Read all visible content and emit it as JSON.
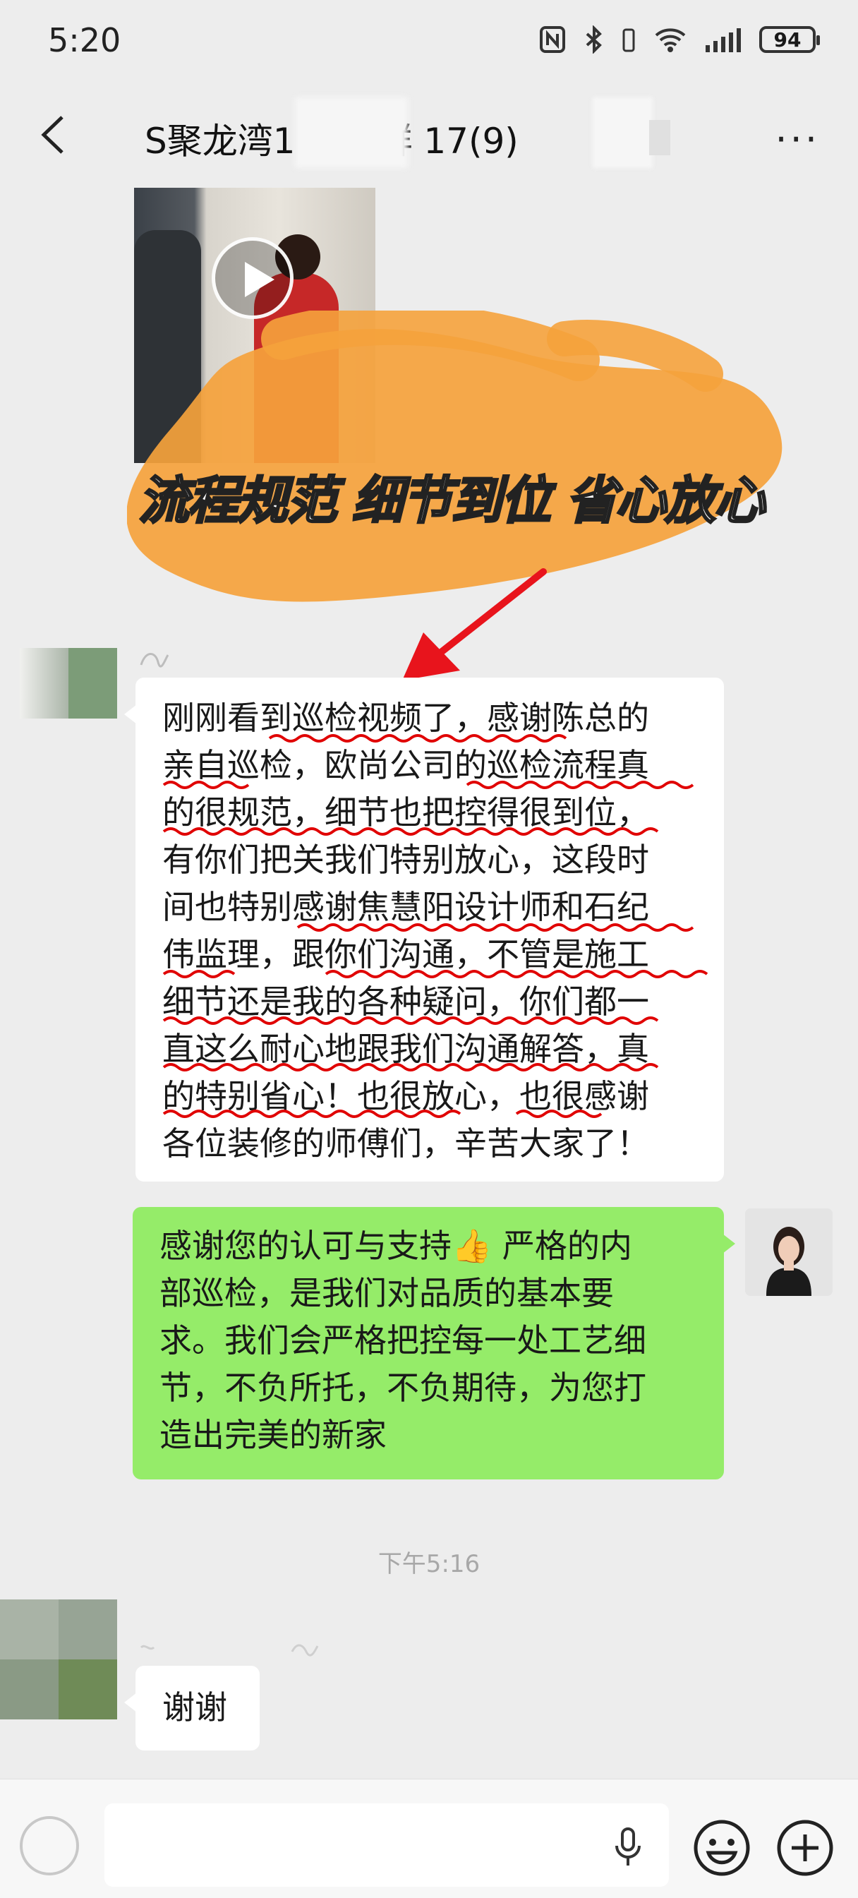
{
  "status_bar": {
    "time": "5:20",
    "battery": "94"
  },
  "header": {
    "title": "S聚龙湾1 施工群 17(9)",
    "more_icon": "ellipsis-icon",
    "back_icon": "chevron-left-icon"
  },
  "video_overlay": {
    "caption": "流程规范 细节到位 省心放心"
  },
  "messages": [
    {
      "side": "left",
      "lines": [
        "刚刚看到巡检视频了，感谢陈总的",
        "亲自巡检，欧尚公司的巡检流程真",
        "的很规范，细节也把控得很到位，",
        "有你们把关我们特别放心，这段时",
        "间也特别感谢焦慧阳设计师和石纪",
        "伟监理，跟你们沟通，不管是施工",
        "细节还是我的各种疑问，你们都一",
        "直这么耐心地跟我们沟通解答，真",
        "的特别省心！也很放心，也很感谢",
        "各位装修的师傅们，辛苦大家了！"
      ]
    },
    {
      "side": "right",
      "lines": [
        "感谢您的认可与支持👍 严格的内",
        "部巡检，是我们对品质的基本要",
        "求。我们会严格把控每一处工艺细",
        "节，不负所托，不负期待，为您打",
        "造出完美的新家"
      ]
    },
    {
      "side": "left",
      "text": "谢谢"
    }
  ],
  "timestamp": "下午5:16",
  "colors": {
    "background": "#ededed",
    "bubble_self": "#95ec69",
    "bubble_other": "#ffffff",
    "accent_orange": "#f5a23c",
    "annotation_red": "#e00000"
  }
}
